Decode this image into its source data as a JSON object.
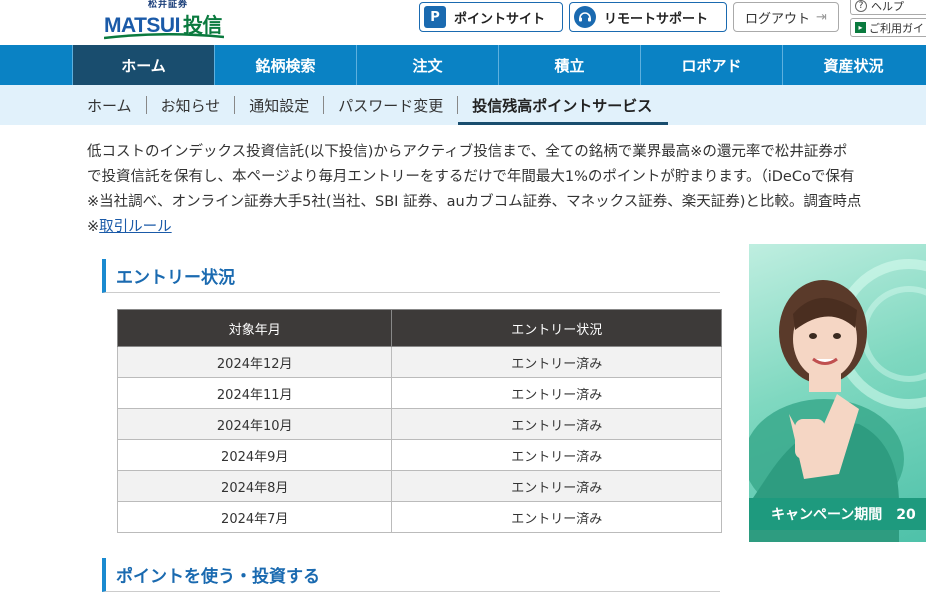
{
  "header": {
    "logo_small": "松井証券",
    "logo_brand": "MATSUI",
    "logo_kanji": "投信",
    "point_icon_glyph": "P",
    "point_site_label": "ポイントサイト",
    "remote_support_label": "リモートサポート",
    "logout_label": "ログアウト",
    "help_label": "ヘルプ",
    "guide_label": "ご利用ガイド"
  },
  "main_nav": {
    "tabs": [
      {
        "label": "ホーム"
      },
      {
        "label": "銘柄検索"
      },
      {
        "label": "注文"
      },
      {
        "label": "積立"
      },
      {
        "label": "ロボアド"
      },
      {
        "label": "資産状況"
      }
    ]
  },
  "sub_nav": {
    "items": [
      {
        "label": "ホーム"
      },
      {
        "label": "お知らせ"
      },
      {
        "label": "通知設定"
      },
      {
        "label": "パスワード変更"
      },
      {
        "label": "投信残高ポイントサービス"
      }
    ]
  },
  "intro": {
    "line1": "低コストのインデックス投資信託(以下投信)からアクティブ投信まで、全ての銘柄で業界最高※の還元率で松井証券ポ",
    "line2": "で投資信託を保有し、本ページより毎月エントリーをするだけで年間最大1%のポイントが貯まります。（iDeCoで保有",
    "line3": "※当社調べ、オンライン証券大手5社(当社、SBI 証券、auカブコム証券、マネックス証券、楽天証券)と比較。調査時点",
    "rule_prefix": "※",
    "rule_link": "取引ルール"
  },
  "entry_section": {
    "heading": "エントリー状況",
    "col_month": "対象年月",
    "col_status": "エントリー状況",
    "rows": [
      {
        "month": "2024年12月",
        "status": "エントリー済み"
      },
      {
        "month": "2024年11月",
        "status": "エントリー済み"
      },
      {
        "month": "2024年10月",
        "status": "エントリー済み"
      },
      {
        "month": "2024年9月",
        "status": "エントリー済み"
      },
      {
        "month": "2024年8月",
        "status": "エントリー済み"
      },
      {
        "month": "2024年7月",
        "status": "エントリー済み"
      }
    ]
  },
  "use_section": {
    "heading": "ポイントを使う・投資する"
  },
  "banner": {
    "campaign_label": "キャンペーン期間　20"
  },
  "colors": {
    "nav_blue": "#0a82c4",
    "nav_active": "#194d6e",
    "subnav_bg": "#e1f1fb",
    "heading_blue": "#1a6ab0",
    "table_header": "#3d3a39",
    "banner_green": "#1e9a7e"
  }
}
